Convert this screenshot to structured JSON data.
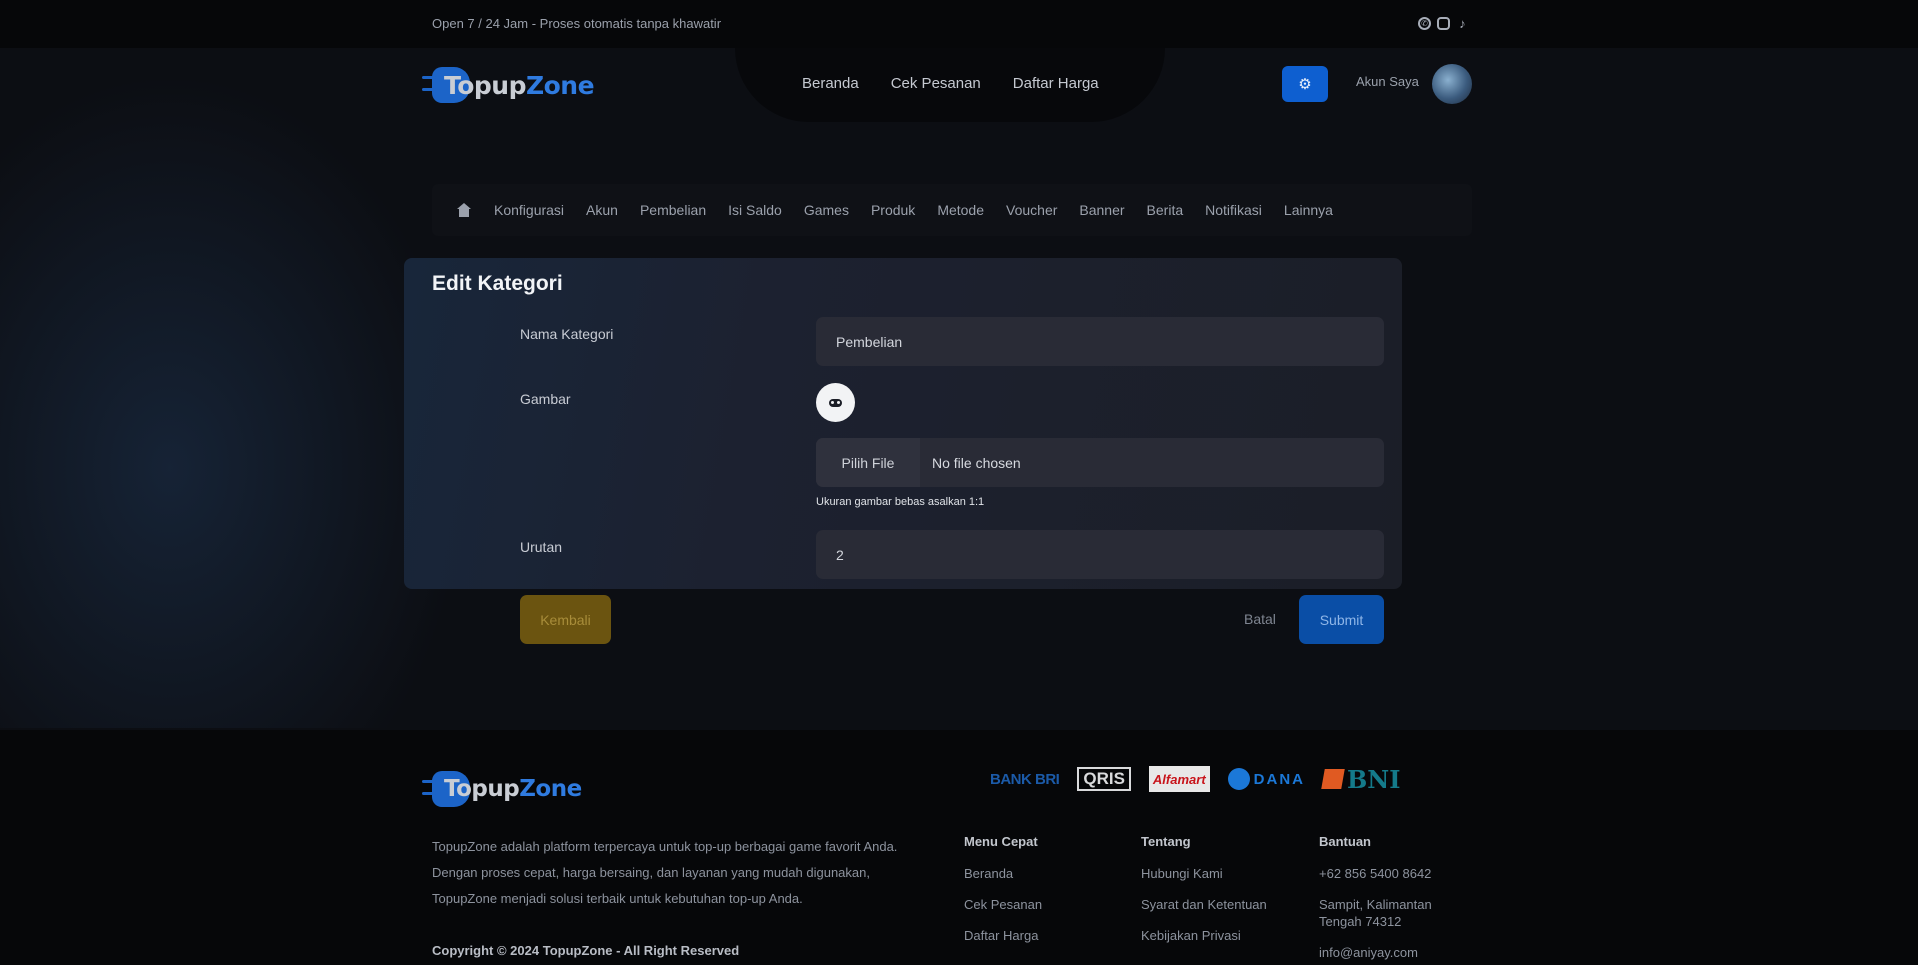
{
  "topbar": {
    "text": "Open 7 / 24 Jam - Proses otomatis tanpa khawatir",
    "social_icons": [
      "whatsapp-icon",
      "instagram-icon",
      "tiktok-icon"
    ]
  },
  "header": {
    "logo_part1": "Topup",
    "logo_part2": "Zone",
    "nav": [
      "Beranda",
      "Cek Pesanan",
      "Daftar Harga"
    ],
    "account_label": "Akun Saya"
  },
  "admin_menu": {
    "items": [
      "Konfigurasi",
      "Akun",
      "Pembelian",
      "Isi Saldo",
      "Games",
      "Produk",
      "Metode",
      "Voucher",
      "Banner",
      "Berita",
      "Notifikasi",
      "Lainnya"
    ]
  },
  "form": {
    "title": "Edit Kategori",
    "nama_label": "Nama Kategori",
    "nama_value": "Pembelian",
    "gambar_label": "Gambar",
    "file_button": "Pilih File",
    "file_name": "No file chosen",
    "file_hint": "Ukuran gambar bebas asalkan 1:1",
    "urutan_label": "Urutan",
    "urutan_value": "2",
    "back_label": "Kembali",
    "cancel_label": "Batal",
    "submit_label": "Submit"
  },
  "footer": {
    "logo_part1": "Topup",
    "logo_part2": "Zone",
    "description": "TopupZone adalah platform terpercaya untuk top-up berbagai game favorit Anda. Dengan proses cepat, harga bersaing, dan layanan yang mudah digunakan, TopupZone menjadi solusi terbaik untuk kebutuhan top-up Anda.",
    "copyright": "Copyright © 2024 TopupZone - All Right Reserved",
    "payments": [
      "BANK BRI",
      "QRIS",
      "Alfamart",
      "DANA",
      "BNI"
    ],
    "columns": [
      {
        "title": "Menu Cepat",
        "items": [
          "Beranda",
          "Cek Pesanan",
          "Daftar Harga"
        ]
      },
      {
        "title": "Tentang",
        "items": [
          "Hubungi Kami",
          "Syarat dan Ketentuan",
          "Kebijakan Privasi"
        ]
      },
      {
        "title": "Bantuan",
        "items": [
          "+62 856 5400 8642",
          "Sampit, Kalimantan Tengah 74312",
          "info@aniyay.com"
        ]
      }
    ]
  },
  "colors": {
    "accent": "#0e5fd0",
    "back_button": "#6b5410",
    "submit_button": "#0a4ea6"
  }
}
